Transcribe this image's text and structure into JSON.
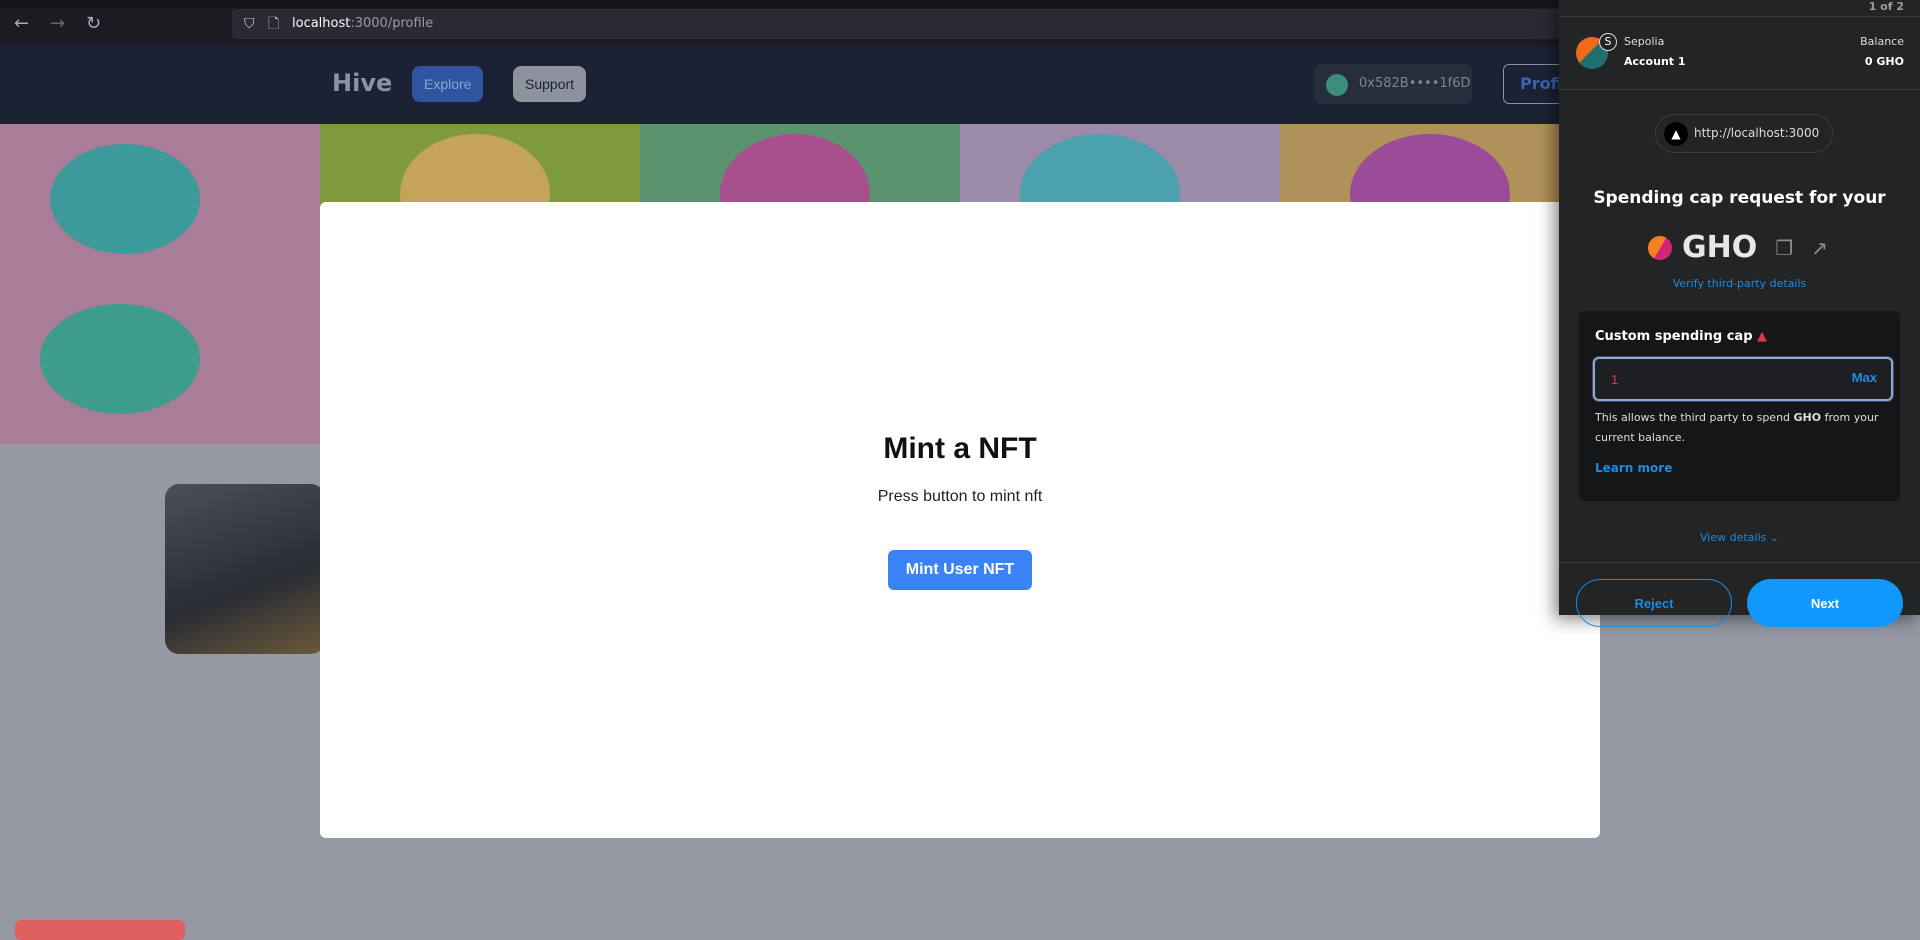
{
  "browser": {
    "url_host": "localhost",
    "url_path": ":3000/profile"
  },
  "header": {
    "logo": "Hive",
    "explore": "Explore",
    "support": "Support",
    "wallet": "0x582B••••1f6D",
    "profile": "Profile"
  },
  "modal": {
    "title": "Mint a NFT",
    "subtitle": "Press button to mint nft",
    "button": "Mint User NFT"
  },
  "metamask": {
    "counter": "1 of 2",
    "network": "Sepolia",
    "network_initial": "S",
    "account": "Account 1",
    "balance_label": "Balance",
    "balance": "0 GHO",
    "origin": "http://localhost:3000",
    "title": "Spending cap request for your",
    "token": "GHO",
    "verify": "Verify third-party details",
    "cap_label": "Custom spending cap",
    "cap_value": "1",
    "max": "Max",
    "desc_pre": "This allows the third party to spend ",
    "desc_token": "GHO",
    "desc_post": " from your current balance.",
    "learn_more": "Learn more",
    "view_details": "View details",
    "reject": "Reject",
    "next": "Next"
  },
  "colors": {
    "accent": "#1098fc",
    "mint": "#3b82f6",
    "warning": "#d73847"
  }
}
